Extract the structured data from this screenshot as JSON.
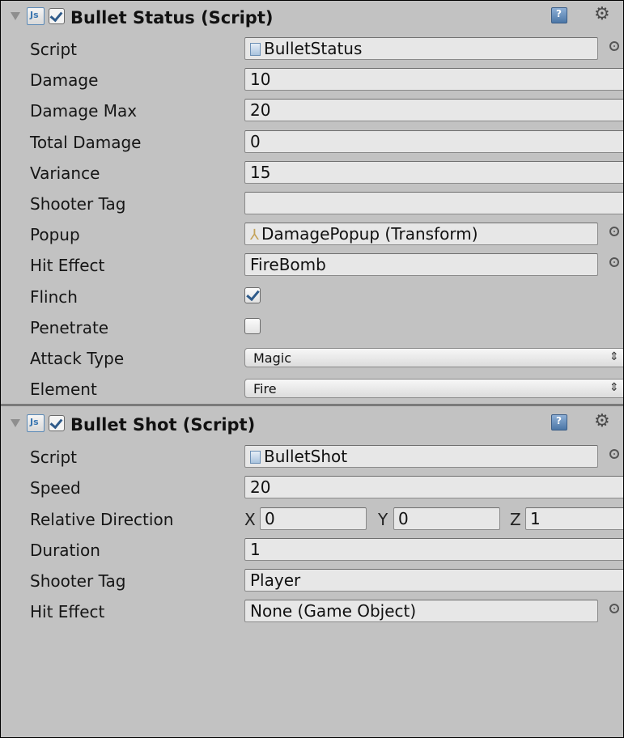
{
  "bullet_status": {
    "title": "Bullet Status (Script)",
    "enabled": true,
    "fields": {
      "script": {
        "label": "Script",
        "value": "BulletStatus"
      },
      "damage": {
        "label": "Damage",
        "value": "10"
      },
      "damage_max": {
        "label": "Damage Max",
        "value": "20"
      },
      "total_damage": {
        "label": "Total Damage",
        "value": "0"
      },
      "variance": {
        "label": "Variance",
        "value": "15"
      },
      "shooter_tag": {
        "label": "Shooter Tag",
        "value": ""
      },
      "popup": {
        "label": "Popup",
        "value": "DamagePopup (Transform)"
      },
      "hit_effect": {
        "label": "Hit Effect",
        "value": "FireBomb"
      },
      "flinch": {
        "label": "Flinch",
        "checked": true
      },
      "penetrate": {
        "label": "Penetrate",
        "checked": false
      },
      "attack_type": {
        "label": "Attack Type",
        "value": "Magic"
      },
      "element": {
        "label": "Element",
        "value": "Fire"
      }
    }
  },
  "bullet_shot": {
    "title": "Bullet Shot (Script)",
    "enabled": true,
    "fields": {
      "script": {
        "label": "Script",
        "value": "BulletShot"
      },
      "speed": {
        "label": "Speed",
        "value": "20"
      },
      "relative_direction": {
        "label": "Relative Direction",
        "x_label": "X",
        "x": "0",
        "y_label": "Y",
        "y": "0",
        "z_label": "Z",
        "z": "1"
      },
      "duration": {
        "label": "Duration",
        "value": "1"
      },
      "shooter_tag": {
        "label": "Shooter Tag",
        "value": "Player"
      },
      "hit_effect": {
        "label": "Hit Effect",
        "value": "None (Game Object)"
      }
    }
  },
  "icons": {
    "script_icon_text": "Js",
    "help_icon_text": "?",
    "gear_icon": "gear-icon",
    "dropdown_arrows": "⇕"
  },
  "colors": {
    "inspector_bg": "#c2c2c2",
    "field_bg": "#e7e7e7",
    "accent_blue": "#2f5b8a"
  }
}
